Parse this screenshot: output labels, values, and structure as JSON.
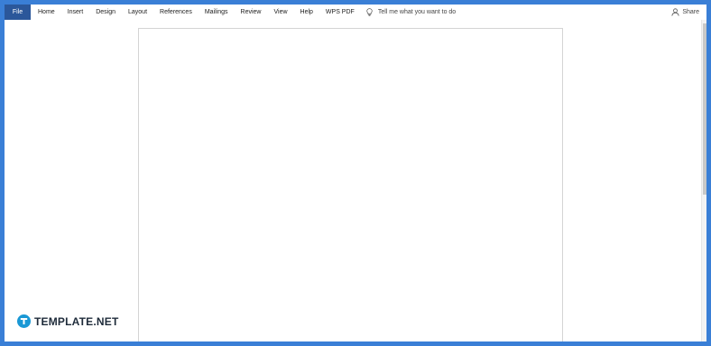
{
  "menubar": {
    "file_label": "File",
    "items": [
      {
        "label": "Home"
      },
      {
        "label": "Insert"
      },
      {
        "label": "Design"
      },
      {
        "label": "Layout"
      },
      {
        "label": "References"
      },
      {
        "label": "Mailings"
      },
      {
        "label": "Review"
      },
      {
        "label": "View"
      },
      {
        "label": "Help"
      },
      {
        "label": "WPS PDF"
      }
    ],
    "tell_me": {
      "icon": "lightbulb-icon",
      "text": "Tell me what you want to do"
    },
    "share": {
      "icon": "person-icon",
      "label": "Share"
    }
  },
  "watermark": {
    "text": "TEMPLATE.NET",
    "icon": "template-logo-icon"
  },
  "colors": {
    "frame": "#3a7fd6",
    "file_tab": "#2b579a",
    "logo_badge": "#1a98d5"
  }
}
